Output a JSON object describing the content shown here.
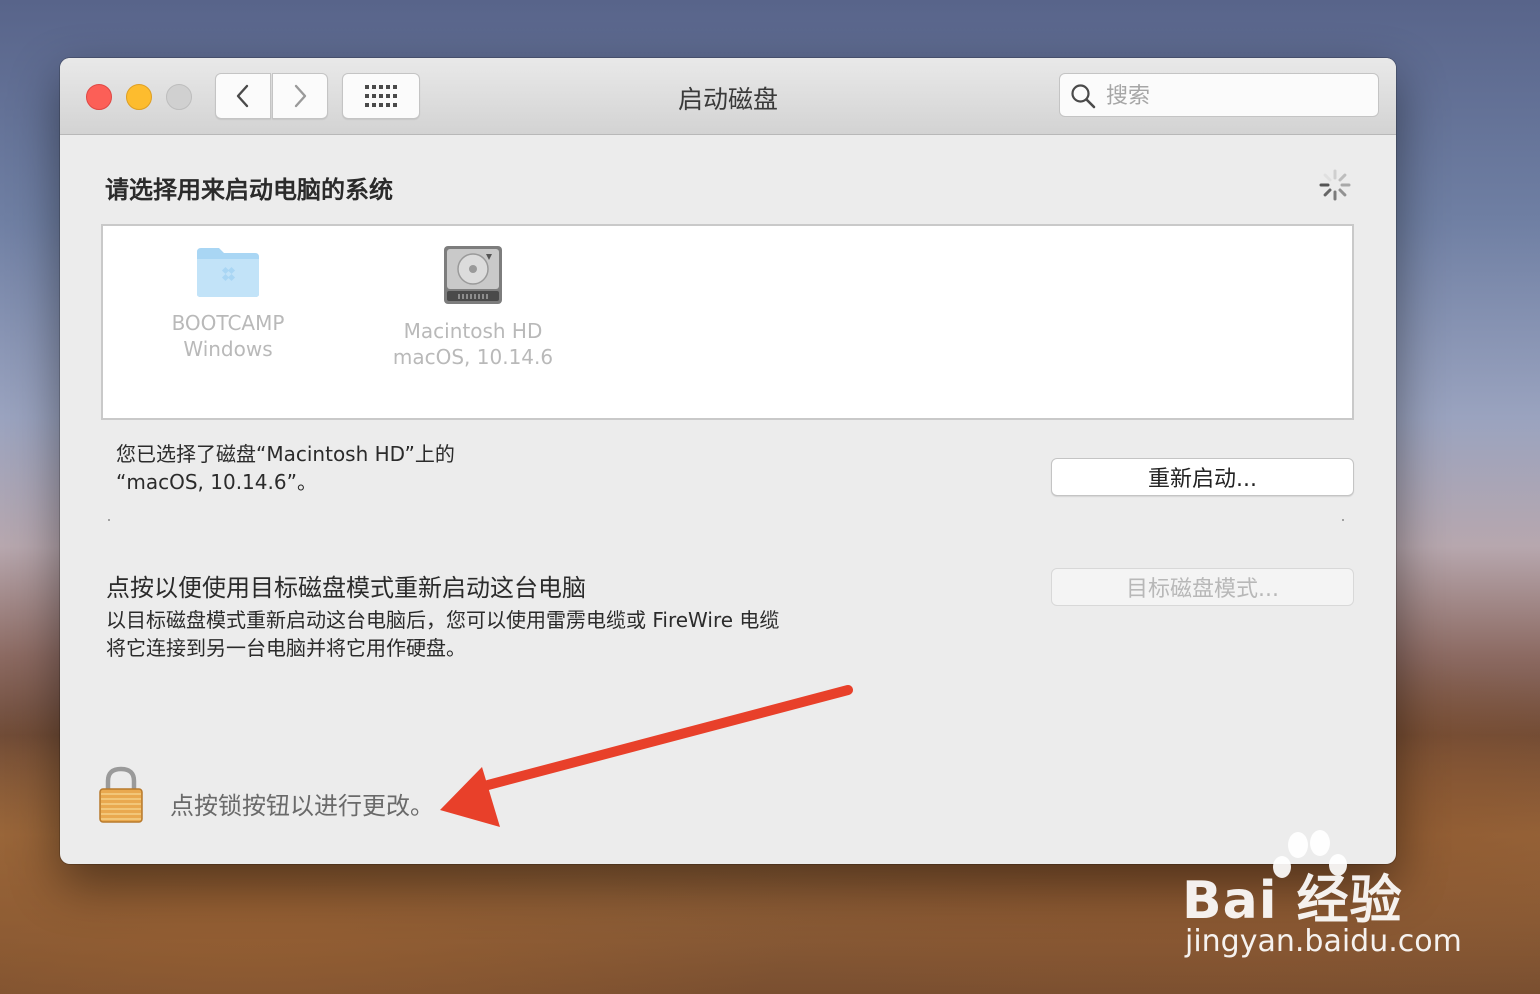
{
  "window": {
    "title": "启动磁盘",
    "search_placeholder": "搜索"
  },
  "main": {
    "heading": "请选择用来启动电脑的系统",
    "disks": [
      {
        "name": "BOOTCAMP",
        "os": "Windows",
        "icon": "bootcamp-folder-icon"
      },
      {
        "name": "Macintosh HD",
        "os": "macOS, 10.14.6",
        "icon": "hard-drive-icon"
      }
    ],
    "selected_line1": "您已选择了磁盘“Macintosh HD”上的",
    "selected_line2": "“macOS, 10.14.6”。",
    "restart_button": "重新启动...",
    "target_title": "点按以便使用目标磁盘模式重新启动这台电脑",
    "target_desc_line1": "以目标磁盘模式重新启动这台电脑后，您可以使用雷雳电缆或 FireWire 电缆",
    "target_desc_line2": "将它连接到另一台电脑并将它用作硬盘。",
    "target_button": "目标磁盘模式...",
    "lock_text": "点按锁按钮以进行更改。"
  },
  "watermark": {
    "brand": "Bai  经验",
    "url": "jingyan.baidu.com"
  },
  "colors": {
    "close": "#fc5f57",
    "minimize": "#fdbc2e",
    "arrow": "#e8402a"
  }
}
